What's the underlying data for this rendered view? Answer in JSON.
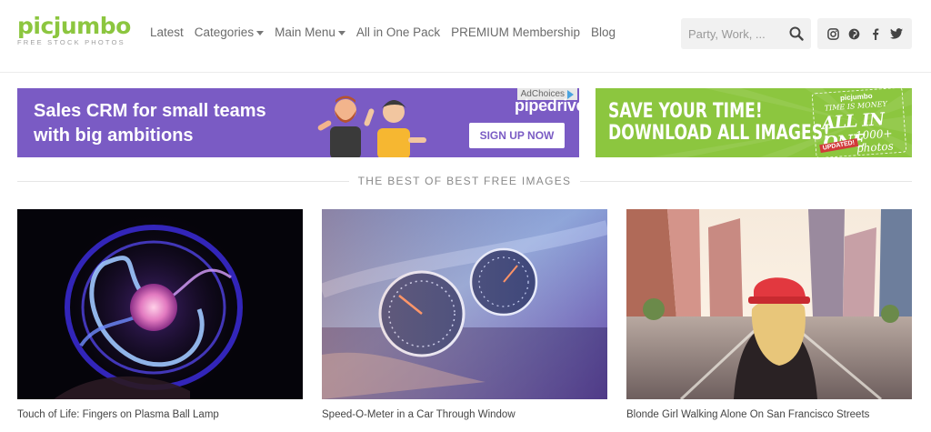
{
  "header": {
    "logo": {
      "name": "picjumbo",
      "tagline": "FREE STOCK PHOTOS"
    },
    "nav": [
      {
        "label": "Latest",
        "dropdown": false
      },
      {
        "label": "Categories",
        "dropdown": true
      },
      {
        "label": "Main Menu",
        "dropdown": true
      },
      {
        "label": "All in One Pack",
        "dropdown": false
      },
      {
        "label": "PREMIUM Membership",
        "dropdown": false
      },
      {
        "label": "Blog",
        "dropdown": false
      }
    ],
    "search": {
      "placeholder": "Party, Work, ...",
      "icon": "search-icon"
    },
    "social": [
      "instagram-icon",
      "pinterest-icon",
      "facebook-icon",
      "twitter-icon"
    ]
  },
  "ads": {
    "crm": {
      "line1": "Sales CRM for small teams",
      "line2": "with big ambitions",
      "brand": "pipedrive",
      "cta": "SIGN UP NOW",
      "adchoices": "AdChoices",
      "bg": "#7a5bc4"
    },
    "pack": {
      "line1": "SAVE YOUR TIME!",
      "line2": "DOWNLOAD ALL IMAGES!",
      "badge_brand": "picjumbo",
      "badge_slogan": "TIME IS MONEY",
      "badge_main": "ALL IN ONE",
      "badge_count": "1000+ photos",
      "badge_updated": "UPDATED!",
      "bg": "#8cc63f"
    }
  },
  "section": {
    "title": "THE BEST OF BEST FREE IMAGES"
  },
  "photos": [
    {
      "caption": "Touch of Life: Fingers on Plasma Ball Lamp"
    },
    {
      "caption": "Speed-O-Meter in a Car Through Window"
    },
    {
      "caption": "Blonde Girl Walking Alone On San Francisco Streets"
    }
  ],
  "colors": {
    "brand_green": "#8cc63f",
    "text_gray": "#6b6b6b"
  }
}
